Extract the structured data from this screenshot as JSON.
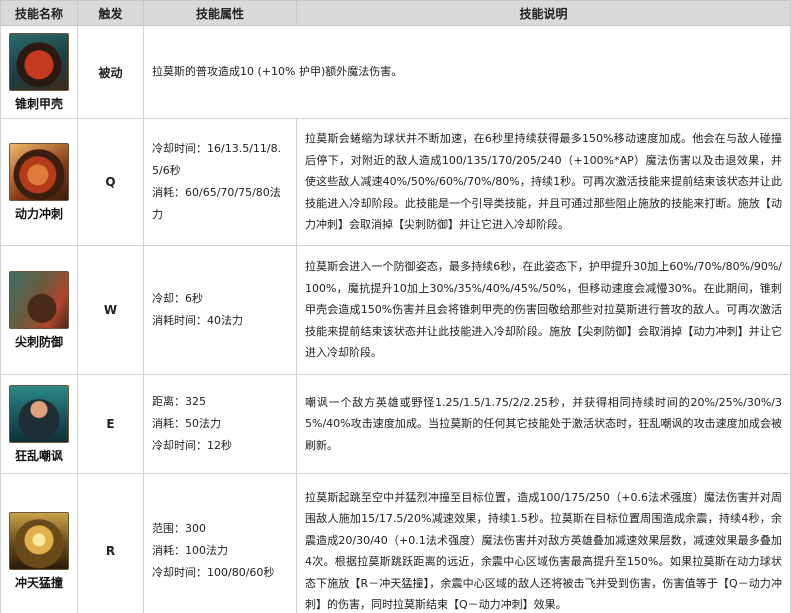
{
  "headers": {
    "name": "技能名称",
    "trigger": "触发",
    "attributes": "技能属性",
    "description": "技能说明"
  },
  "skills": [
    {
      "name": "锥刺甲壳",
      "icon": "spiked-shell-icon",
      "trigger": "被动",
      "attributes": [],
      "description": "拉莫斯的普攻造成10 (+10% 护甲)额外魔法伤害。"
    },
    {
      "name": "动力冲刺",
      "icon": "powerball-icon",
      "trigger": "Q",
      "attributes": [
        "冷却时间：16/13.5/11/8.5/6秒",
        "消耗：60/65/70/75/80法力"
      ],
      "description": "拉莫斯会蜷缩为球状并不断加速，在6秒里持续获得最多150%移动速度加成。他会在与敌人碰撞后停下，对附近的敌人造成100/135/170/205/240（+100%*AP）魔法伤害以及击退效果，并使这些敌人减速40%/50%/60%/70%/80%，持续1秒。可再次激活技能来提前结束该状态并让此技能进入冷却阶段。此技能是一个引导类技能，并且可通过那些阻止施放的技能来打断。施放【动力冲刺】会取消掉【尖刺防御】并让它进入冷却阶段。"
    },
    {
      "name": "尖刺防御",
      "icon": "defensive-ball-curl-icon",
      "trigger": "W",
      "attributes": [
        "冷却：6秒",
        "消耗时间：40法力"
      ],
      "description": "拉莫斯会进入一个防御姿态，最多持续6秒，在此姿态下，护甲提升30加上60%/70%/80%/90%/100%，魔抗提升10加上30%/35%/40%/45%/50%，但移动速度会减慢30%。在此期间，锥刺甲壳会造成150%伤害并且会将锥刺甲壳的伤害回敬给那些对拉莫斯进行普攻的敌人。可再次激活技能来提前结束该状态并让此技能进入冷却阶段。施放【尖刺防御】会取消掉【动力冲刺】并让它进入冷却阶段。"
    },
    {
      "name": "狂乱嘲讽",
      "icon": "puncturing-taunt-icon",
      "trigger": "E",
      "attributes": [
        "距离：325",
        "消耗：50法力",
        "冷却时间：12秒"
      ],
      "description": "嘲讽一个敌方英雄或野怪1.25/1.5/1.75/2/2.25秒，并获得相同持续时间的20%/25%/30%/35%/40%攻击速度加成。当拉莫斯的任何其它技能处于激活状态时，狂乱嘲讽的攻击速度加成会被刷新。"
    },
    {
      "name": "冲天猛撞",
      "icon": "soaring-slam-icon",
      "trigger": "R",
      "attributes": [
        "范围：300",
        "消耗：100法力",
        "冷却时间：100/80/60秒"
      ],
      "description": "拉莫斯起跳至空中并猛烈冲撞至目标位置，造成100/175/250（+0.6法术强度）魔法伤害并对周围敌人施加15/17.5/20%减速效果，持续1.5秒。拉莫斯在目标位置周围造成余震，持续4秒，余震造成20/30/40（+0.1法术强度）魔法伤害并对敌方英雄叠加减速效果层数，减速效果最多叠加4次。根据拉莫斯跳跃距离的远近，余震中心区域伤害最高提升至150%。如果拉莫斯在动力球状态下施放【R－冲天猛撞】，余震中心区域的敌人还将被击飞并受到伤害，伤害值等于【Q－动力冲刺】的伤害，同时拉莫斯结束【Q－动力冲刺】效果。"
    }
  ]
}
